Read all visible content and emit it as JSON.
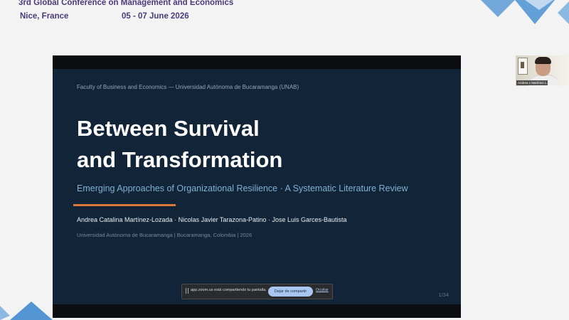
{
  "conference": {
    "title": "3rd Global Conference on Management and Economics",
    "location": "Nice, France",
    "dates": "05 - 07 June 2026"
  },
  "slide": {
    "faculty": "Faculty of Business and Economics — Universidad Autónoma de Bucaramanga (UNAB)",
    "title_line1": "Between Survival",
    "title_line2": "and Transformation",
    "subtitle": "Emerging Approaches of Organizational Resilience · A Systematic Literature Review",
    "authors": "Andrea Catalina Martínez-Lozada  ·  Nicolas Javier Tarazona-Patino  ·  Jose Luis Garces-Bautista",
    "affiliation": "Universidad Autónoma de Bucaramanga  |  Bucaramanga, Colombia  |  2026",
    "page": "1/34"
  },
  "share_bar": {
    "message": "app.zoom.us está compartiendo tu pantalla.",
    "stop_label": "Dejar de compartir",
    "hide_label": "Ocultar"
  },
  "video": {
    "participant_name": "Andrea c Martínez L..."
  },
  "colors": {
    "brand_purple": "#4a3a7a",
    "slide_bg": "#122538",
    "accent_orange": "#d9793a",
    "deco_blue": "#5b9bd5"
  }
}
